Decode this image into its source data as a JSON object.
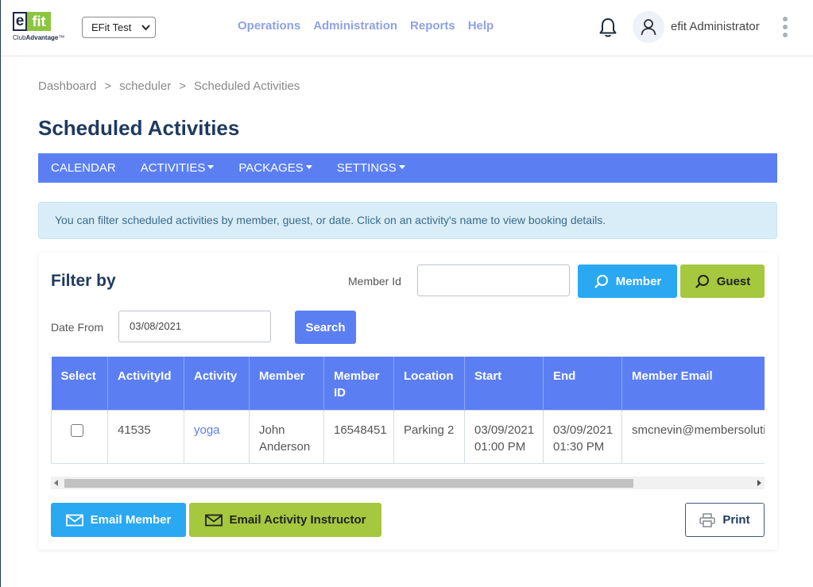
{
  "header": {
    "logo_e": "e",
    "logo_fit": "fit",
    "logo_sub_club": "Club",
    "logo_sub_advantage": "Advantage",
    "logo_tm": "™",
    "club_selector_value": "EFit Test",
    "nav": [
      {
        "label": "Operations"
      },
      {
        "label": "Administration"
      },
      {
        "label": "Reports"
      },
      {
        "label": "Help"
      }
    ],
    "user_name": "efit Administrator",
    "icons": {
      "notifications": "bell-icon",
      "user": "user-icon",
      "more": "kebab-menu-icon"
    }
  },
  "breadcrumb": {
    "items": [
      "Dashboard",
      "scheduler",
      "Scheduled Activities"
    ],
    "separator": ">"
  },
  "page_title": "Scheduled Activities",
  "menu": {
    "items": [
      {
        "label": "CALENDAR",
        "has_dropdown": false
      },
      {
        "label": "ACTIVITIES",
        "has_dropdown": true
      },
      {
        "label": "PACKAGES",
        "has_dropdown": true
      },
      {
        "label": "SETTINGS",
        "has_dropdown": true
      }
    ]
  },
  "info_message": "You can filter scheduled activities by member, guest, or date. Click on an activity's name to view booking details.",
  "filter": {
    "title": "Filter by",
    "member_id_label": "Member Id",
    "member_id_value": "",
    "member_button": "Member",
    "guest_button": "Guest",
    "date_from_label": "Date From",
    "date_from_value": "03/08/2021",
    "search_button": "Search"
  },
  "table": {
    "columns": [
      "Select",
      "ActivityId",
      "Activity",
      "Member",
      "Member ID",
      "Location",
      "Start",
      "End",
      "Member Email"
    ],
    "rows": [
      {
        "selected": false,
        "activity_id": "41535",
        "activity": "yoga",
        "member": "John Anderson",
        "member_id": "16548451",
        "location": "Parking 2",
        "start": "03/09/2021 01:00 PM",
        "end": "03/09/2021 01:30 PM",
        "member_email": "smcnevin@membersolutions.com"
      }
    ]
  },
  "actions": {
    "email_member": "Email Member",
    "email_instructor": "Email Activity Instructor",
    "print": "Print"
  },
  "colors": {
    "primary_blue": "#5b7ff2",
    "light_blue": "#2aa8f2",
    "green": "#a5c83f",
    "title_navy": "#1f3a5f",
    "nav_link": "#8ea1e6",
    "info_bg": "#d9edf8"
  }
}
